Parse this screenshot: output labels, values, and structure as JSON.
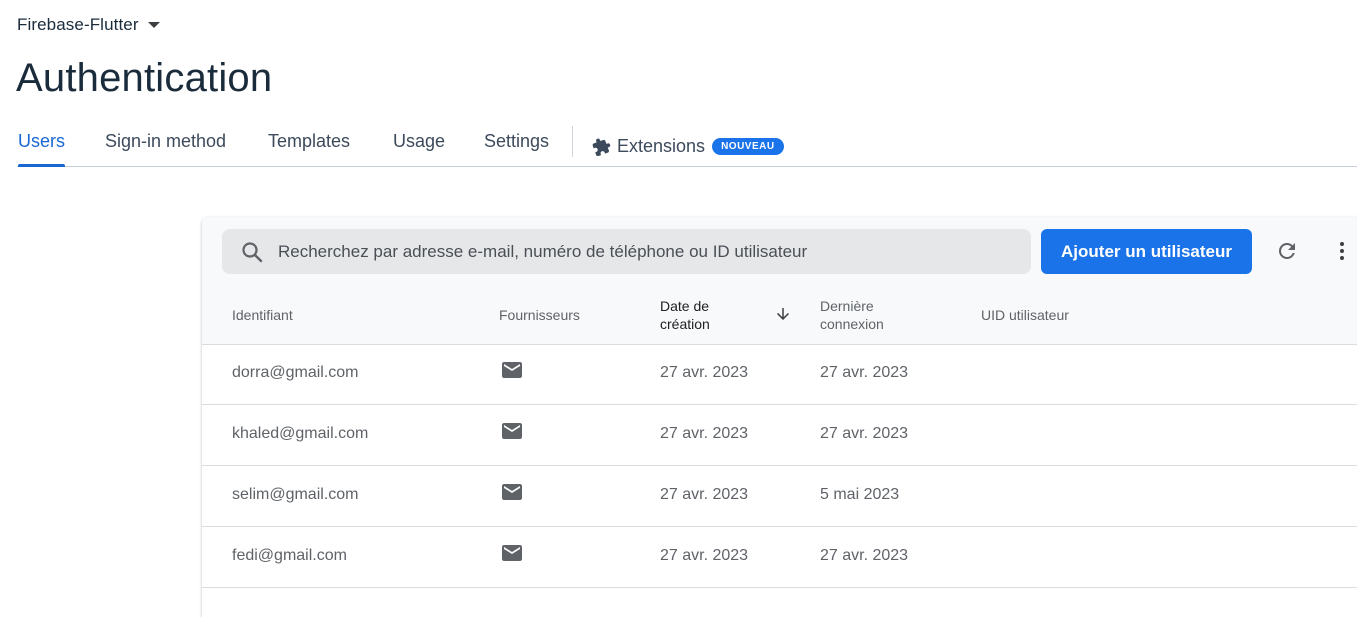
{
  "project": {
    "name": "Firebase-Flutter"
  },
  "page": {
    "title": "Authentication"
  },
  "tabs": [
    {
      "label": "Users"
    },
    {
      "label": "Sign-in method"
    },
    {
      "label": "Templates"
    },
    {
      "label": "Usage"
    },
    {
      "label": "Settings"
    },
    {
      "label": "Extensions",
      "badge": "NOUVEAU"
    }
  ],
  "toolbar": {
    "search_placeholder": "Recherchez par adresse e-mail, numéro de téléphone ou ID utilisateur",
    "add_user_label": "Ajouter un utilisateur"
  },
  "table": {
    "columns": [
      "Identifiant",
      "Fournisseurs",
      "Date de création",
      "Dernière connexion",
      "UID utilisateur"
    ],
    "sorted_column": "Date de création",
    "sort_direction": "descending",
    "rows": [
      {
        "identifier": "dorra@gmail.com",
        "provider": "mail-icon",
        "created": "27 avr. 2023",
        "last_signin": "27 avr. 2023",
        "uid": ""
      },
      {
        "identifier": "khaled@gmail.com",
        "provider": "mail-icon",
        "created": "27 avr. 2023",
        "last_signin": "27 avr. 2023",
        "uid": ""
      },
      {
        "identifier": "selim@gmail.com",
        "provider": "mail-icon",
        "created": "27 avr. 2023",
        "last_signin": "5 mai 2023",
        "uid": ""
      },
      {
        "identifier": "fedi@gmail.com",
        "provider": "mail-icon",
        "created": "27 avr. 2023",
        "last_signin": "27 avr. 2023",
        "uid": ""
      }
    ]
  },
  "colors": {
    "accent": "#1a73e8",
    "title": "#1a2b3c"
  }
}
